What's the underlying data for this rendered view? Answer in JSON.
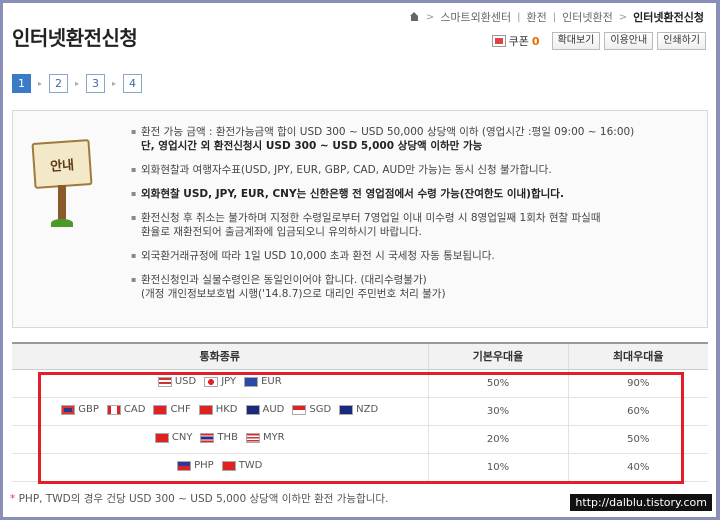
{
  "breadcrumb": {
    "items": [
      "스마트외환센터",
      "환전",
      "인터넷환전"
    ],
    "current": "인터넷환전신청"
  },
  "page_title": "인터넷환전신청",
  "toolbar": {
    "coupon_label": "쿠폰",
    "coupon_count": "0",
    "buttons": [
      "확대보기",
      "이용안내",
      "인쇄하기"
    ]
  },
  "steps": [
    "1",
    "2",
    "3",
    "4"
  ],
  "notice": {
    "sign_label": "안내",
    "items": [
      {
        "line1": "환전 가능 금액 : 환전가능금액 합이 USD 300 ~ USD 50,000 상당액 이하 (영업시간 :평일 09:00 ~ 16:00)",
        "line2": "단, 영업시간 외 환전신청시 USD 300 ~ USD 5,000 상당액 이하만 가능"
      },
      {
        "line1": "외화현찰과 여행자수표(USD, JPY, EUR, GBP, CAD, AUD만 가능)는 동시 신청 불가합니다."
      },
      {
        "line1": "외화현찰 USD, JPY, EUR, CNY는 신한은행 전 영업점에서 수령 가능(잔여한도 이내)합니다."
      },
      {
        "line1": "환전신청 후 취소는 불가하며 지정한 수령일로부터 7영업일 이내 미수령 시 8영업일째 1회차 현찰 파실때",
        "line2": "환율로 재환전되어 출금계좌에 입금되오니 유의하시기 바랍니다."
      },
      {
        "line1": "외국환거래규정에 따라 1일 USD 10,000 초과 환전 시 국세청 자동 통보됩니다."
      },
      {
        "line1": "환전신청인과 실물수령인은 동일인이어야 합니다. (대리수령불가)",
        "line2": "(개정 개인정보보호법 시행('14.8.7)으로 대리인 주민번호 처리 불가)"
      }
    ]
  },
  "table": {
    "headers": [
      "통화종류",
      "기본우대율",
      "최대우대율"
    ],
    "rows": [
      {
        "currencies": [
          [
            "us",
            "USD"
          ],
          [
            "jp",
            "JPY"
          ],
          [
            "eu",
            "EUR"
          ]
        ],
        "base": "50%",
        "max": "90%"
      },
      {
        "currencies": [
          [
            "gb",
            "GBP"
          ],
          [
            "ca",
            "CAD"
          ],
          [
            "ch",
            "CHF"
          ],
          [
            "hk",
            "HKD"
          ],
          [
            "au",
            "AUD"
          ],
          [
            "sg",
            "SGD"
          ],
          [
            "nz",
            "NZD"
          ]
        ],
        "base": "30%",
        "max": "60%"
      },
      {
        "currencies": [
          [
            "cn",
            "CNY"
          ],
          [
            "th",
            "THB"
          ],
          [
            "my",
            "MYR"
          ]
        ],
        "base": "20%",
        "max": "50%"
      },
      {
        "currencies": [
          [
            "ph",
            "PHP"
          ],
          [
            "tw",
            "TWD"
          ]
        ],
        "base": "10%",
        "max": "40%"
      }
    ]
  },
  "footnote": {
    "mark": "*",
    "text": " PHP, TWD의 경우 건당 USD 300 ~ USD 5,000 상당액 이하만 환전 가능합니다."
  },
  "watermark": "http://dalblu.tistory.com",
  "colors": {
    "highlight": "#e01f2a",
    "step_active": "#3a7bc8",
    "coupon_count": "#e66a00"
  }
}
